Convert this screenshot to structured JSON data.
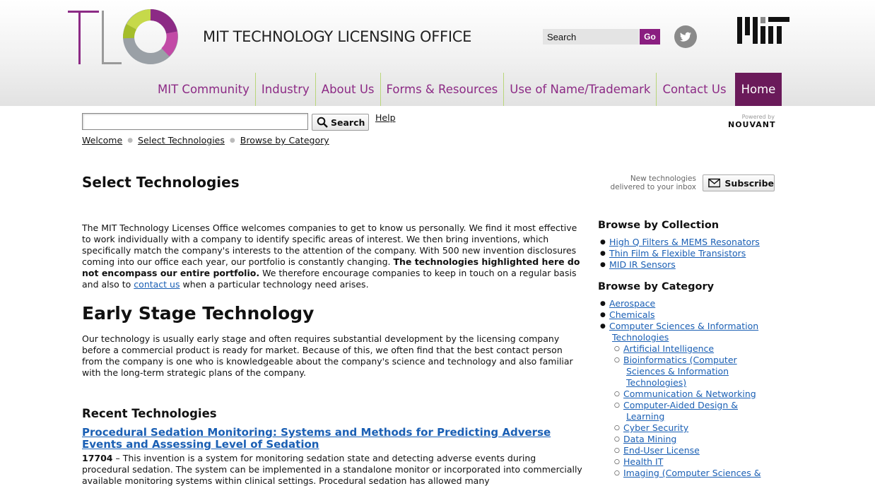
{
  "header": {
    "logo_text": "TLO",
    "site_title": "MIT TECHNOLOGY LICENSING OFFICE",
    "search_placeholder": "Search",
    "go_label": "Go",
    "mit_logo_text": "MIT",
    "twitter_icon": "twitter-bird-icon",
    "accent_color": "#8a1e80"
  },
  "nav": {
    "items": [
      {
        "label": "MIT Community"
      },
      {
        "label": "Industry"
      },
      {
        "label": "About Us"
      },
      {
        "label": "Forms & Resources"
      },
      {
        "label": "Use of Name/Trademark"
      },
      {
        "label": "Contact Us"
      },
      {
        "label": "Home"
      }
    ],
    "active_color": "#6a1a5a",
    "link_color": "#8c2a85"
  },
  "toolbar": {
    "search_value": "",
    "search_button": "Search",
    "help_label": "Help",
    "powered_by": "Powered by",
    "powered_brand": "NOUVANT"
  },
  "breadcrumb": [
    "Welcome",
    "Select Technologies",
    "Browse by Category"
  ],
  "page": {
    "title": "Select Technologies",
    "subscribe_note_1": "New technologies",
    "subscribe_note_2": "delivered to your inbox",
    "subscribe_label": "Subscribe"
  },
  "intro": {
    "text_1": "The MIT Technology Licenses Office welcomes companies to get to know us personally. We find it most effective to work individually with a company to identify specific areas of interest. We then bring inventions, which specifically match the company's interests to the attention of the company. With 500 new invention disclosures coming into our office each year, our portfolio is constantly changing.",
    "bold": "The technologies highlighted here do not encompass our entire portfolio.",
    "text_2": "We therefore encourage companies to keep in touch on a regular basis and also to",
    "link": "contact us",
    "text_3": "when a particular technology need arises."
  },
  "early_stage": {
    "heading": "Early Stage Technology",
    "text": "Our technology is usually early stage and often requires substantial development by the licensing company before a commercial product is ready for market. Because of this, we often find that the best contact person from the company is one who is knowledgeable about the company's science and technology and also familiar with the long-term strategic plans of the company."
  },
  "recent": {
    "heading": "Recent Technologies",
    "items": [
      {
        "title": "Procedural Sedation Monitoring: Systems and Methods for Predicting Adverse Events and Assessing Level of Sedation",
        "id": "17704",
        "desc": " – This invention is a system for monitoring sedation state and detecting adverse events during procedural sedation. The system can be implemented in a standalone monitor or incorporated into commercially available monitoring systems within clinical settings. Procedural sedation has allowed many"
      }
    ]
  },
  "sidebar": {
    "collection_heading": "Browse by Collection",
    "collections": [
      {
        "label": "High Q Filters & MEMS Resonators"
      },
      {
        "label": "Thin Film & Flexible Transistors"
      },
      {
        "label": "MID IR Sensors"
      }
    ],
    "category_heading": "Browse by Category",
    "categories": [
      {
        "label": "Aerospace"
      },
      {
        "label": "Chemicals"
      },
      {
        "label": "Computer Sciences & Information Technologies"
      }
    ],
    "subcategories": [
      {
        "label": "Artificial Intelligence"
      },
      {
        "label": "Bioinformatics (Computer Sciences & Information Technologies)"
      },
      {
        "label": "Communication & Networking"
      },
      {
        "label": "Computer-Aided Design & Learning"
      },
      {
        "label": "Cyber Security"
      },
      {
        "label": "Data Mining"
      },
      {
        "label": "End-User License"
      },
      {
        "label": "Health IT"
      },
      {
        "label": "Imaging (Computer Sciences &"
      }
    ]
  }
}
